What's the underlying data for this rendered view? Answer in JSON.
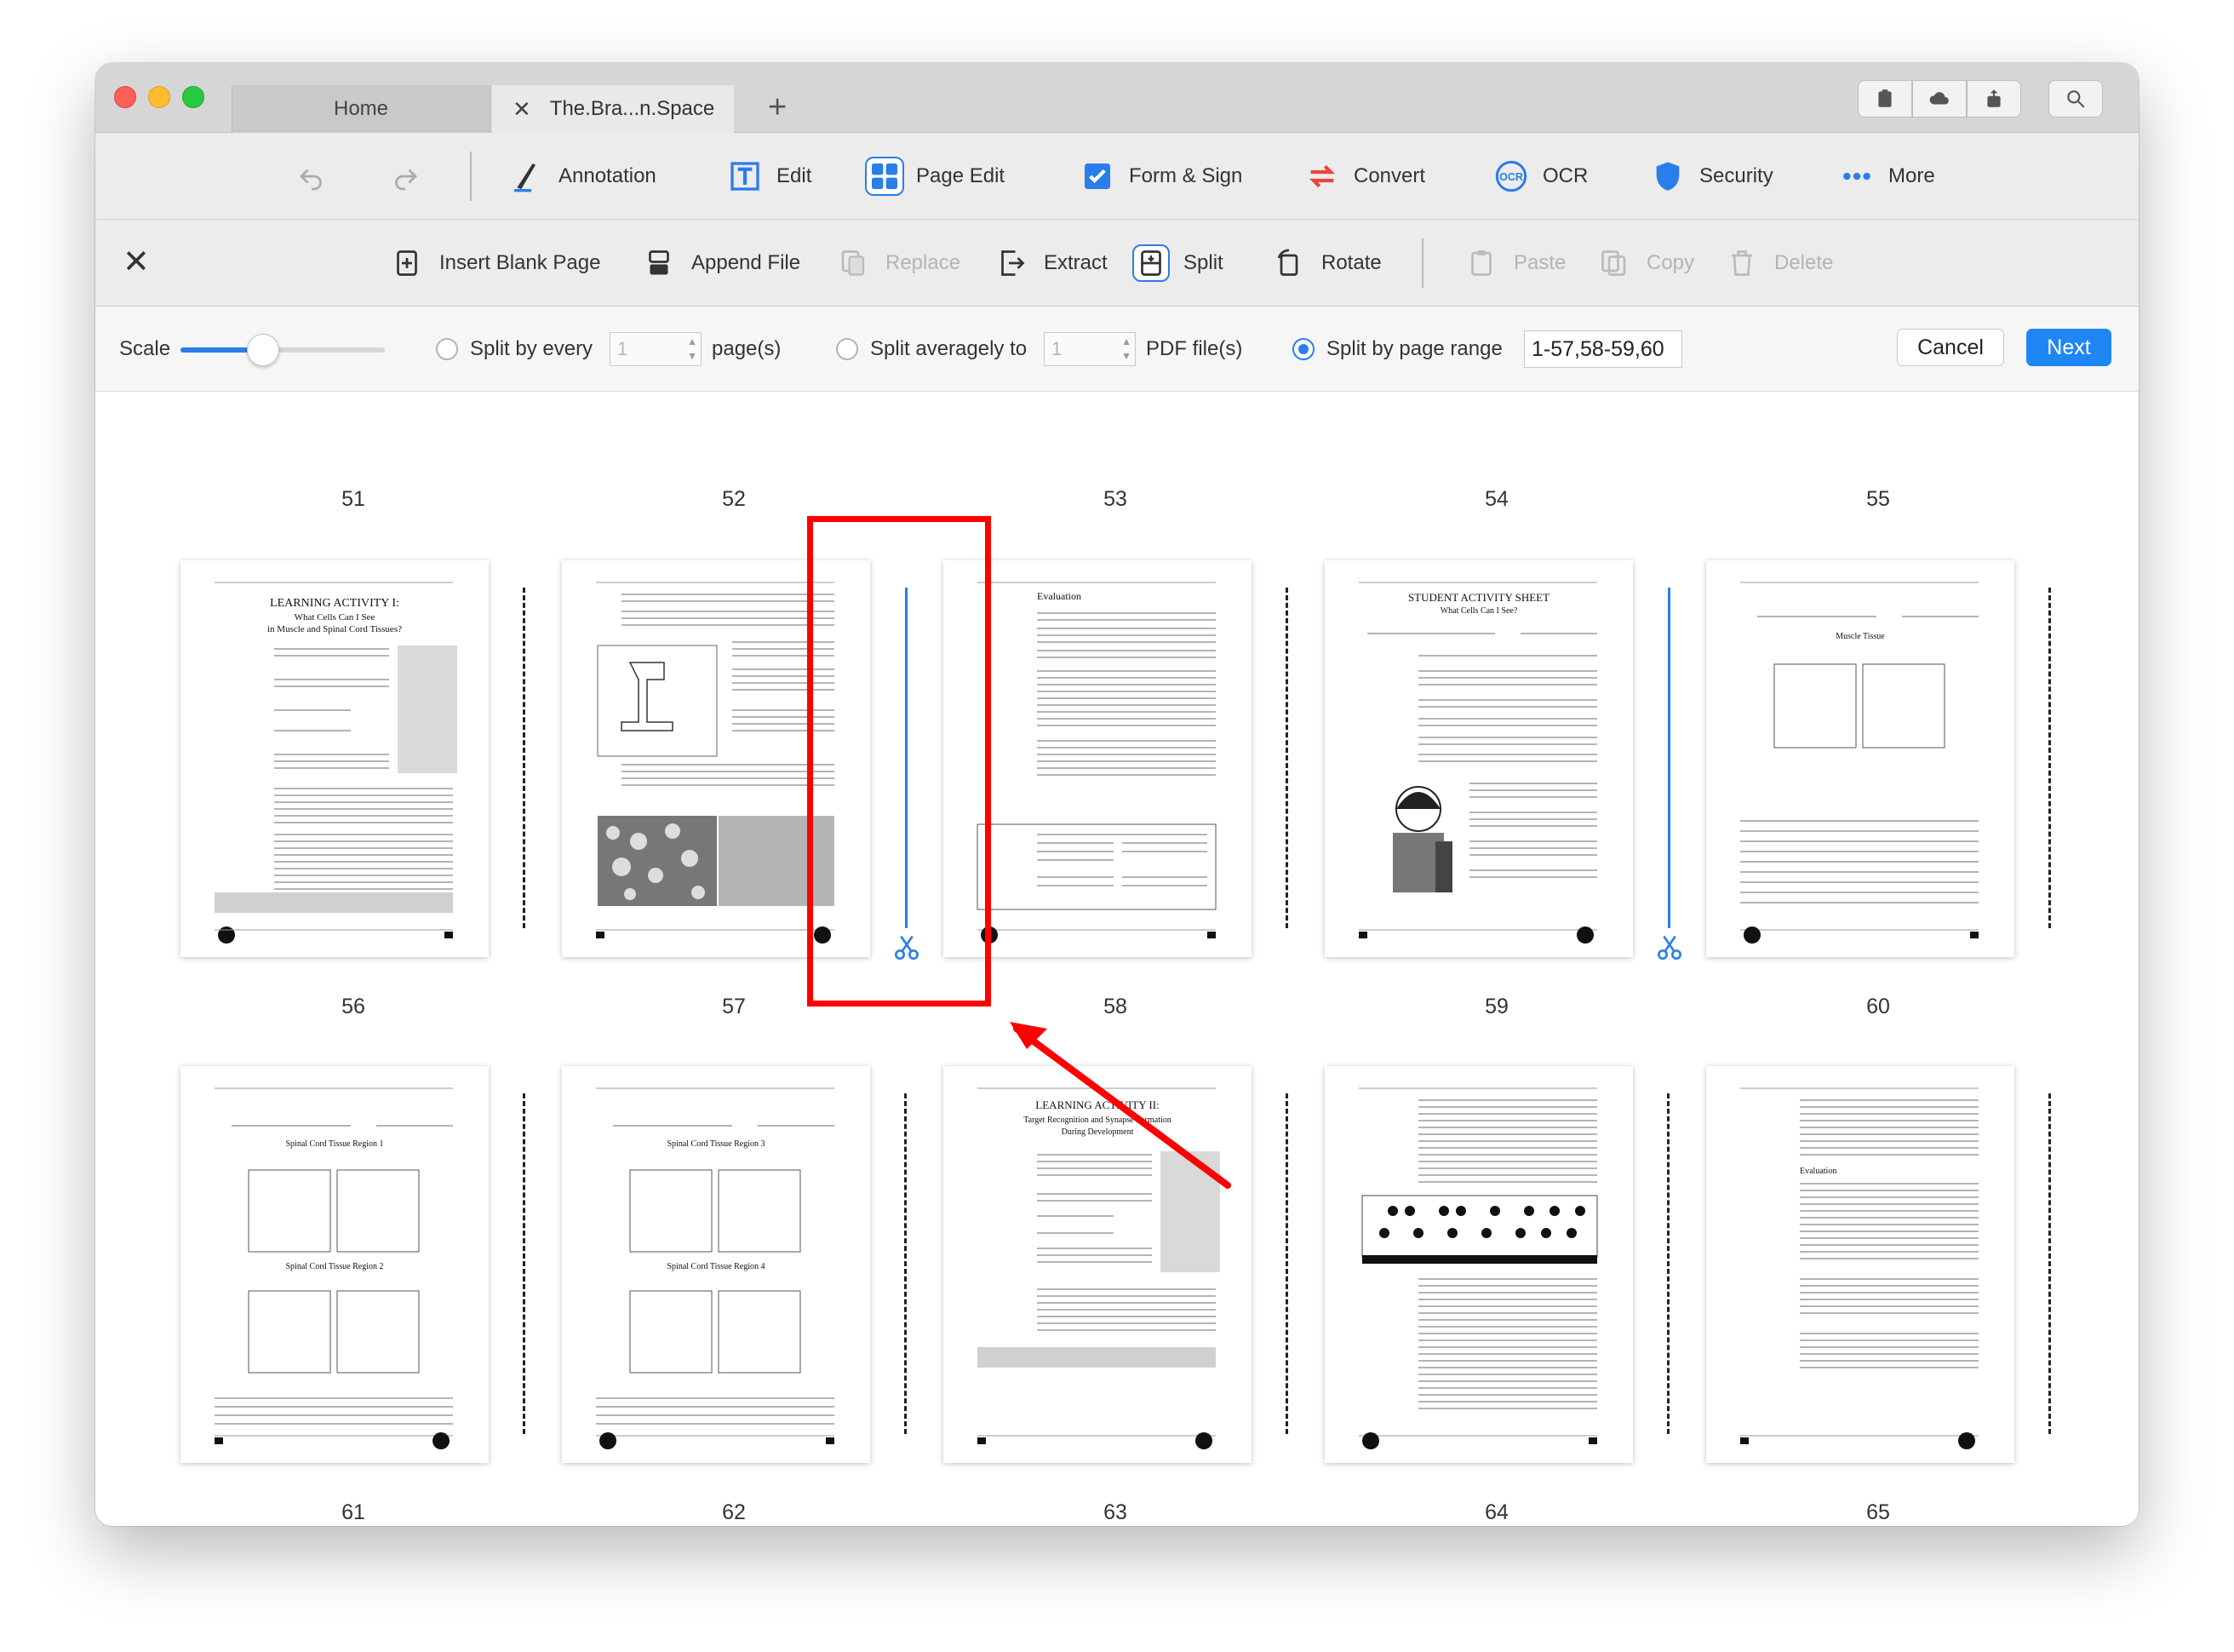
{
  "tabs": {
    "home": "Home",
    "doc": "The.Bra...n.Space"
  },
  "toolbar": {
    "annotation": "Annotation",
    "edit": "Edit",
    "page_edit": "Page Edit",
    "form_sign": "Form & Sign",
    "convert": "Convert",
    "ocr": "OCR",
    "security": "Security",
    "more": "More"
  },
  "subbar": {
    "insert_blank": "Insert Blank Page",
    "append_file": "Append File",
    "replace": "Replace",
    "extract": "Extract",
    "split": "Split",
    "rotate": "Rotate",
    "paste": "Paste",
    "copy": "Copy",
    "delete": "Delete"
  },
  "options": {
    "scale_label": "Scale",
    "scale_level": 0.3,
    "split_every_label": "Split by every",
    "split_every_value": "1",
    "split_every_unit": "page(s)",
    "split_avg_label": "Split averagely to",
    "split_avg_value": "1",
    "split_avg_unit": "PDF file(s)",
    "split_range_label": "Split by page range",
    "split_range_value": "1-57,58-59,60",
    "selected_mode": "range",
    "cancel": "Cancel",
    "next": "Next"
  },
  "pages": {
    "row0": [
      "51",
      "52",
      "53",
      "54",
      "55"
    ],
    "row1": [
      "56",
      "57",
      "58",
      "59",
      "60"
    ],
    "row2": [
      "61",
      "62",
      "63",
      "64",
      "65"
    ]
  },
  "thumb_titles": {
    "p56": "LEARNING ACTIVITY I:",
    "p56b": "What Cells Can I See",
    "p56c": "in Muscle and Spinal Cord Tissues?",
    "p58": "Evaluation",
    "p59": "STUDENT ACTIVITY SHEET",
    "p59b": "What Cells Can I See?",
    "p60": "Muscle Tissue",
    "p61a": "Spinal Cord Tissue Region 1",
    "p61b": "Spinal Cord Tissue Region 2",
    "p62a": "Spinal Cord Tissue Region 3",
    "p62b": "Spinal Cord Tissue Region 4",
    "p63": "LEARNING ACTIVITY II:",
    "p63b": "Target Recognition and Synapse Formation",
    "p63c": "During Development",
    "p65": "Evaluation"
  },
  "colors": {
    "accent": "#2b7de9",
    "highlight": "#ff0000",
    "next_button": "#1f86f5"
  }
}
